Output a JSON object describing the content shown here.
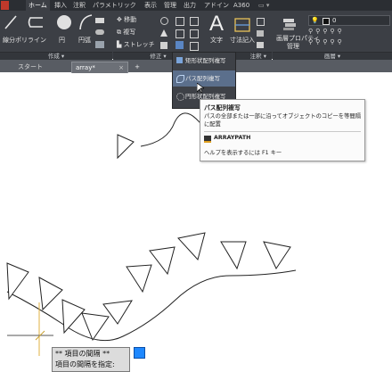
{
  "ribbon": {
    "tabs": [
      "ホーム",
      "挿入",
      "注釈",
      "パラメトリック",
      "表示",
      "管理",
      "出力",
      "アドイン",
      "A360"
    ],
    "tools": {
      "line": "線分",
      "polyline": "ポリライン",
      "circle": "円",
      "arc": "円弧",
      "move": "移動",
      "copy": "複写",
      "stretch": "ストレッチ",
      "text": "文字",
      "dimension": "寸法記入",
      "layer_props": "画層プロパティ",
      "layer_props2": "管理",
      "layer_name": "0"
    },
    "groups": {
      "draw": "作成 ▾",
      "modify": "修正 ▾",
      "annotation": "注釈 ▾",
      "layers": "画層 ▾"
    }
  },
  "doc_tabs": {
    "start": "スタート",
    "drawing": "array*",
    "close": "×",
    "add": "+"
  },
  "array_menu": {
    "items": [
      "矩形状配列複写",
      "パス配列複写",
      "円形状配列複写"
    ],
    "selected_index": 1
  },
  "tooltip": {
    "title": "パス配列複写",
    "description": "パスの全部または一部に沿ってオブジェクトのコピーを等間隔に配置",
    "command": "ARRAYPATH",
    "help": "ヘルプを表示するには F1 キー"
  },
  "command_prompt": {
    "line1": "** 項目の間隔 **",
    "line2": "項目の間隔を指定:"
  },
  "colors": {
    "ribbon_bg": "#3c3f45",
    "tab_bar": "#2b2e33",
    "menu_highlight": "#5b6f8c",
    "input_box": "#1e88ff",
    "drawing_lines": "#222222",
    "cursor_yellow": "#e0b040"
  }
}
